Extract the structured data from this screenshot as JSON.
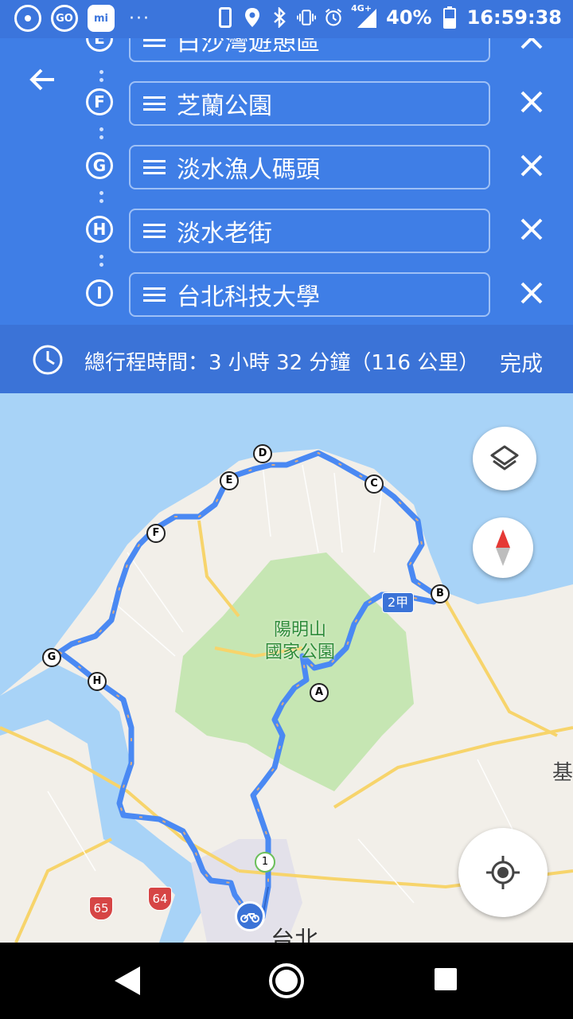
{
  "status_bar": {
    "app_icons": [
      "chrome-icon",
      "go-icon",
      "mi-icon"
    ],
    "app_icon_labels": {
      "go": "GO",
      "mi": "mi"
    },
    "more": "···",
    "network": "4G+",
    "battery": "40%",
    "time": "16:59:38"
  },
  "stops": [
    {
      "letter": "E",
      "name": "白沙灣遊憩區"
    },
    {
      "letter": "F",
      "name": "芝蘭公園"
    },
    {
      "letter": "G",
      "name": "淡水漁人碼頭"
    },
    {
      "letter": "H",
      "name": "淡水老街"
    },
    {
      "letter": "I",
      "name": "台北科技大學"
    }
  ],
  "summary": {
    "total_time": "總行程時間：3 小時 32 分鐘（116 公里）",
    "done_label": "完成"
  },
  "map": {
    "park_label_1": "陽明山",
    "park_label_2": "國家公園",
    "city_label": "台北",
    "edge_label": "基",
    "route_shields": [
      "2甲",
      "65",
      "64"
    ],
    "waypoint_markers": [
      "A",
      "B",
      "C",
      "D",
      "E",
      "F",
      "G",
      "H"
    ],
    "start_marker": "1",
    "colors": {
      "route": "#4a89f3",
      "water": "#a8d3f7",
      "land": "#f2efe9",
      "park": "#c6e6b3"
    }
  },
  "colors": {
    "header": "#3f7ee6",
    "status_bar": "#3b75dc",
    "summary": "#3b73d7"
  }
}
